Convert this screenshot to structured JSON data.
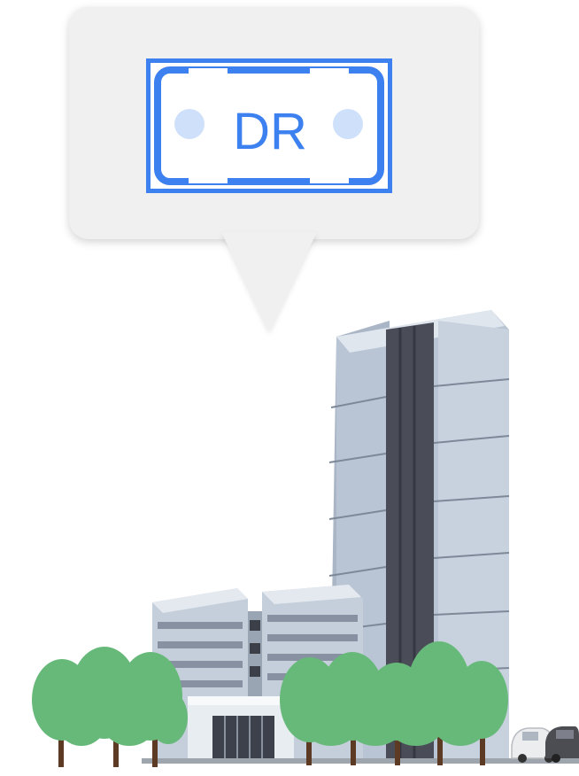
{
  "license_plate": {
    "text": "DR",
    "plate_color": "#3d80ef",
    "hole_color": "#cfe0fb"
  },
  "bubble": {
    "background": "#f0f0f0"
  },
  "scene": {
    "icons": [
      "speech-bubble",
      "license-plate",
      "hospital-building",
      "tree",
      "car"
    ]
  }
}
